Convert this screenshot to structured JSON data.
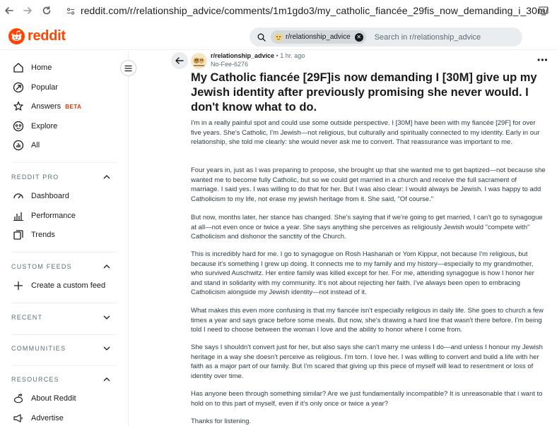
{
  "browser": {
    "url_domain": "reddit.com",
    "url_path": "/r/relationship_advice/comments/1m1gdo3/my_catholic_fiancée_29fis_now_demanding_i_30m/"
  },
  "header": {
    "logo_text": "reddit",
    "search_chip": "r/relationship_advice",
    "search_placeholder": "Search in r/relationship_advice",
    "brand_color": "#ff4500"
  },
  "sidebar": {
    "items": [
      {
        "label": "Home",
        "icon": "home-icon"
      },
      {
        "label": "Popular",
        "icon": "popular-icon"
      },
      {
        "label": "Answers",
        "icon": "answers-icon",
        "badge": "BETA"
      },
      {
        "label": "Explore",
        "icon": "explore-icon"
      },
      {
        "label": "All",
        "icon": "all-icon"
      }
    ],
    "sections": {
      "reddit_pro": "REDDIT PRO",
      "custom_feeds": "CUSTOM FEEDS",
      "recent": "RECENT",
      "communities": "COMMUNITIES",
      "resources": "RESOURCES"
    },
    "pro_items": [
      {
        "label": "Dashboard",
        "icon": "dashboard-icon"
      },
      {
        "label": "Performance",
        "icon": "performance-icon"
      },
      {
        "label": "Trends",
        "icon": "trends-icon"
      }
    ],
    "create_feed": "Create a custom feed",
    "resources_items": [
      {
        "label": "About Reddit",
        "icon": "about-icon"
      },
      {
        "label": "Advertise",
        "icon": "advertise-icon"
      }
    ]
  },
  "post": {
    "subreddit": "r/relationship_advice",
    "separator": "•",
    "time": "1 hr. ago",
    "author": "No-Fee-6276",
    "title": "My Catholic fiancée [29F]is now demanding I [30M] give up my Jewish identity after previously promising she never would. I don't know what to do.",
    "paragraphs": [
      "I'm in a really painful spot and could use some outside perspective. I [30M] have been with my fiancée [29F] for over five years. She's Catholic, I'm Jewish—not religious, but culturally and spiritually connected to my identity. Early in our relationship, she told me clearly: she would never ask me to convert. That reassurance was important to me.",
      "Four years in, just as I was preparing to propose, she brought up that she wanted me to get baptized—not because she wanted me to become fully Catholic, but so we could get married in a church and receive the full sacrament of marriage. I said yes. I was willing to do that for her. But I was also clear: I would always be Jewish. I was happy to add Catholicism to my life, not erase my jewish heritage from it. She said, \"Of course.\"",
      "But now, months later, her stance has changed. She's saying that if we're going to get married, I can't go to synagogue at all—not even once or twice a year. She says anything she perceives as religiously Jewish would \"compete with\" Catholicism and dishonor the sanctity of the Church.",
      "This is incredibly hard for me. I go to synagogue on Rosh Hashanah or Yom Kippur, not because I'm religious, but because it's something I grew up doing. It connects me to my family and my history—especially to my grandmother, who survived Auschwitz. Her entire family was killed except for her. For me, attending synagogue is how I honor her and stand in solidarity with my community. It's not about rejecting her faith. I've always been open to embracing Catholicism alongside my Jewish identity—not instead of it.",
      "What makes this even more confusing is that my fiancée isn't especially religious in daily life. She goes to church a few times a year and says grace before some meals. But now, she's drawing a hard line that wasn't there before. I'm being told I need to choose between the woman I love and the ability to honor where I come from.",
      "She says I shouldn't convert just for her, but also says she can't marry me unless I do—and unless I honour my Jewish heritage in a way she doesn't perceive as religious. I'm torn. I love her. I was willing to convert and build a life with her faith as a major part of our family. But I'm scared that giving up this piece of myself will lead to resentment or loss of identity over time.",
      "Has anyone been through something similar? Are we just fundamentally incompatible? It is unreasonable that i want to hold on to this part of myself, even if it's only once or twice a year?",
      "Thanks for listening."
    ]
  }
}
